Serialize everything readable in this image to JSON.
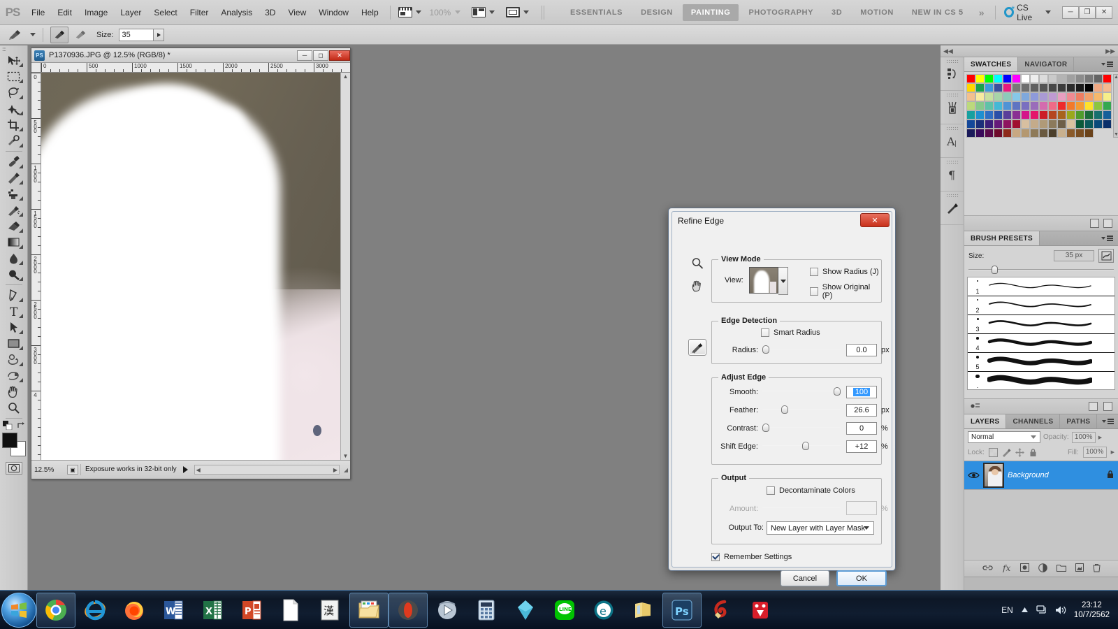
{
  "app": {
    "name": "Adobe Photoshop CS5",
    "logo": "PS"
  },
  "menubar": {
    "items": [
      "File",
      "Edit",
      "Image",
      "Layer",
      "Select",
      "Filter",
      "Analysis",
      "3D",
      "View",
      "Window",
      "Help"
    ],
    "zoom_level": "100%",
    "icons": [
      "screen-mode-icon",
      "arrange-documents-icon",
      "screen-mode-frame-icon"
    ],
    "workspaces": [
      {
        "label": "ESSENTIALS",
        "active": false
      },
      {
        "label": "DESIGN",
        "active": false
      },
      {
        "label": "PAINTING",
        "active": true
      },
      {
        "label": "PHOTOGRAPHY",
        "active": false
      },
      {
        "label": "3D",
        "active": false
      },
      {
        "label": "MOTION",
        "active": false
      },
      {
        "label": "NEW IN CS 5",
        "active": false
      }
    ],
    "more_workspaces": "»",
    "cs_live": "CS Live",
    "window_buttons": [
      "minimize",
      "restore",
      "close"
    ]
  },
  "options_bar": {
    "tool": "brush-tool",
    "size_label": "Size:",
    "size_value": "35"
  },
  "toolbar": {
    "tools": [
      {
        "name": "move-tool"
      },
      {
        "name": "rectangular-marquee-tool"
      },
      {
        "name": "lasso-tool"
      },
      {
        "name": "quick-selection-tool"
      },
      {
        "name": "crop-tool"
      },
      {
        "name": "eyedropper-tool"
      },
      {
        "name": "spot-healing-brush-tool"
      },
      {
        "name": "brush-tool"
      },
      {
        "name": "clone-stamp-tool"
      },
      {
        "name": "history-brush-tool"
      },
      {
        "name": "eraser-tool"
      },
      {
        "name": "gradient-tool"
      },
      {
        "name": "blur-tool"
      },
      {
        "name": "dodge-tool"
      },
      {
        "name": "pen-tool"
      },
      {
        "name": "horizontal-type-tool"
      },
      {
        "name": "path-selection-tool"
      },
      {
        "name": "rectangle-tool"
      },
      {
        "name": "3d-rotate-tool"
      },
      {
        "name": "3d-orbit-tool"
      },
      {
        "name": "hand-tool"
      },
      {
        "name": "zoom-tool"
      }
    ],
    "foreground_color": "#101010",
    "background_color": "#ffffff"
  },
  "document": {
    "title": "P1370936.JPG @ 12.5% (RGB/8) *",
    "zoom": "12.5%",
    "status_message": "Exposure works in 32-bit only",
    "ruler_h_labels": [
      "0",
      "500",
      "1000",
      "1500",
      "2000",
      "2500",
      "3000"
    ],
    "ruler_v_labels": [
      "0",
      "500",
      "1000",
      "1500",
      "2000",
      "2500",
      "3000",
      "4"
    ],
    "window_buttons": [
      "minimize",
      "maximize",
      "close"
    ]
  },
  "dialog": {
    "title": "Refine Edge",
    "close_label": "✕",
    "tools": [
      "zoom-tool",
      "hand-tool",
      "refine-radius-brush-tool"
    ],
    "view_mode": {
      "group_title": "View Mode",
      "view_label": "View:",
      "show_radius": {
        "label": "Show Radius (J)",
        "checked": false
      },
      "show_original": {
        "label": "Show Original (P)",
        "checked": false
      }
    },
    "edge_detection": {
      "group_title": "Edge Detection",
      "smart_radius": {
        "label": "Smart Radius",
        "checked": false
      },
      "radius_label": "Radius:",
      "radius_value": "0.0",
      "radius_unit": "px",
      "radius_percent": 0
    },
    "adjust_edge": {
      "group_title": "Adjust Edge",
      "rows": [
        {
          "label": "Smooth:",
          "value": "100",
          "unit": "",
          "percent": 100,
          "selected": true
        },
        {
          "label": "Feather:",
          "value": "26.6",
          "unit": "px",
          "percent": 26.6,
          "selected": false
        },
        {
          "label": "Contrast:",
          "value": "0",
          "unit": "%",
          "percent": 0,
          "selected": false
        },
        {
          "label": "Shift Edge:",
          "value": "+12",
          "unit": "%",
          "percent": 56,
          "selected": false
        }
      ]
    },
    "output": {
      "group_title": "Output",
      "decontaminate": {
        "label": "Decontaminate Colors",
        "checked": false
      },
      "amount_label": "Amount:",
      "amount_value": "",
      "amount_unit": "%",
      "output_to_label": "Output To:",
      "output_to_value": "New Layer with Layer Mask"
    },
    "remember_settings": {
      "label": "Remember Settings",
      "checked": true
    },
    "cancel_label": "Cancel",
    "ok_label": "OK"
  },
  "panels": {
    "swatches": {
      "tabs": [
        {
          "label": "SWATCHES",
          "active": true
        },
        {
          "label": "NAVIGATOR",
          "active": false
        }
      ],
      "colors": [
        "#ff0000",
        "#ffff00",
        "#00ff00",
        "#00ffff",
        "#0000ff",
        "#ff00ff",
        "#ffffff",
        "#ededed",
        "#dcdcdc",
        "#cacaca",
        "#b4b4b4",
        "#a0a0a0",
        "#8c8c8c",
        "#787878",
        "#646464",
        "#ff0000",
        "#ffd800",
        "#18a34a",
        "#3a9ad9",
        "#3b4f9e",
        "#e8197f",
        "#787878",
        "#6e6e6e",
        "#606060",
        "#545454",
        "#484848",
        "#3c3c3c",
        "#2c2c2c",
        "#1a1a1a",
        "#000000",
        "#f0a882",
        "#f5b98f",
        "#f3c08e",
        "#f7eaa0",
        "#c8e0a0",
        "#a8d4a8",
        "#8ccaba",
        "#86c8e8",
        "#7fa8dc",
        "#8e9ada",
        "#a99ad4",
        "#bf9ad2",
        "#e89ec0",
        "#f08a92",
        "#ef7e62",
        "#f2a06a",
        "#f6b86c",
        "#f6ef8a",
        "#bcd97c",
        "#86c98c",
        "#5fc2a8",
        "#44b8d6",
        "#4f93d6",
        "#5f74c2",
        "#7a6fc0",
        "#9a6cba",
        "#d46cae",
        "#ef6b87",
        "#ee2b2b",
        "#f37a2a",
        "#f59b30",
        "#ffe12a",
        "#8cc63f",
        "#34a850",
        "#16a0a0",
        "#1f8fd0",
        "#2f6ec4",
        "#2a4fa8",
        "#5b3f9a",
        "#8a2f93",
        "#d4168a",
        "#e4176b",
        "#cc1c26",
        "#b5461f",
        "#a8631c",
        "#9aa81c",
        "#4f9b2c",
        "#1a6b3a",
        "#166f6f",
        "#155f9a",
        "#14489a",
        "#1b2f7a",
        "#3c1f7a",
        "#661a7a",
        "#8e1460",
        "#a01030",
        "#d8bfa0",
        "#c4ab8a",
        "#b09a78",
        "#8c7a5c",
        "#6e5f48",
        "#d8c2a0",
        "#0a5a3a",
        "#0a5a5a",
        "#0a4a7a",
        "#0a2f6a",
        "#1a1a5a",
        "#3a0a5a",
        "#5a0a4a",
        "#6e0a2a",
        "#8e2a1a",
        "#c8a882",
        "#b49870",
        "#8e7a58",
        "#6a5a40",
        "#4a3e2a",
        "#c8b08e",
        "#8a5a2a",
        "#7a4e22",
        "#6a421a"
      ]
    },
    "brush_presets": {
      "tabs": [
        {
          "label": "BRUSH PRESETS",
          "active": true
        }
      ],
      "size_label": "Size:",
      "size_value": "35 px",
      "size_percent": 16,
      "items": [
        {
          "num": "1",
          "dot": 2,
          "thickness": 1.3
        },
        {
          "num": "2",
          "dot": 2.4,
          "thickness": 1.8
        },
        {
          "num": "3",
          "dot": 3,
          "thickness": 2.6
        },
        {
          "num": "4",
          "dot": 3.6,
          "thickness": 4.4
        },
        {
          "num": "5",
          "dot": 4.4,
          "thickness": 6.2
        },
        {
          "num": ".",
          "dot": 5.2,
          "thickness": 7.6
        }
      ]
    },
    "layers": {
      "tabs": [
        {
          "label": "LAYERS",
          "active": true
        },
        {
          "label": "CHANNELS",
          "active": false
        },
        {
          "label": "PATHS",
          "active": false
        }
      ],
      "blend_mode": "Normal",
      "opacity_label": "Opacity:",
      "opacity_value": "100%",
      "lock_label": "Lock:",
      "fill_label": "Fill:",
      "fill_value": "100%",
      "lock_icons": [
        "lock-transparency-icon",
        "lock-image-icon",
        "lock-position-icon",
        "lock-all-icon"
      ],
      "items": [
        {
          "name": "Background",
          "selected": true,
          "locked": true,
          "visible": true
        }
      ],
      "footer_icons": [
        "link-layers-icon",
        "layer-style-icon",
        "layer-mask-icon",
        "adjustment-layer-icon",
        "new-group-icon",
        "new-layer-icon",
        "delete-layer-icon"
      ]
    },
    "rail_icons": [
      "history-icon",
      "tool-presets-icon",
      "character-icon",
      "paragraph-icon",
      "brush-icon"
    ]
  },
  "taskbar": {
    "start_label": "start-orb-icon",
    "items": [
      {
        "name": "chrome",
        "active": true
      },
      {
        "name": "internet-explorer",
        "active": false
      },
      {
        "name": "firefox",
        "active": false
      },
      {
        "name": "word",
        "active": false
      },
      {
        "name": "excel",
        "active": false
      },
      {
        "name": "powerpoint",
        "active": false
      },
      {
        "name": "document",
        "active": false
      },
      {
        "name": "thai-input",
        "active": false
      },
      {
        "name": "file-explorer",
        "active": true
      },
      {
        "name": "opera",
        "active": true
      },
      {
        "name": "media-player",
        "active": false
      },
      {
        "name": "calculator",
        "active": false
      },
      {
        "name": "diamond-app",
        "active": false
      },
      {
        "name": "line",
        "active": false
      },
      {
        "name": "edge-app",
        "active": false
      },
      {
        "name": "folder-app",
        "active": false
      },
      {
        "name": "photoshop",
        "active": true
      },
      {
        "name": "ccleaner",
        "active": false
      },
      {
        "name": "camtasia",
        "active": false
      }
    ],
    "language": "EN",
    "time": "23:12",
    "date": "10/7/2562",
    "tray_icons": [
      "show-hidden-icons-arrow",
      "network-icon",
      "volume-icon"
    ]
  }
}
